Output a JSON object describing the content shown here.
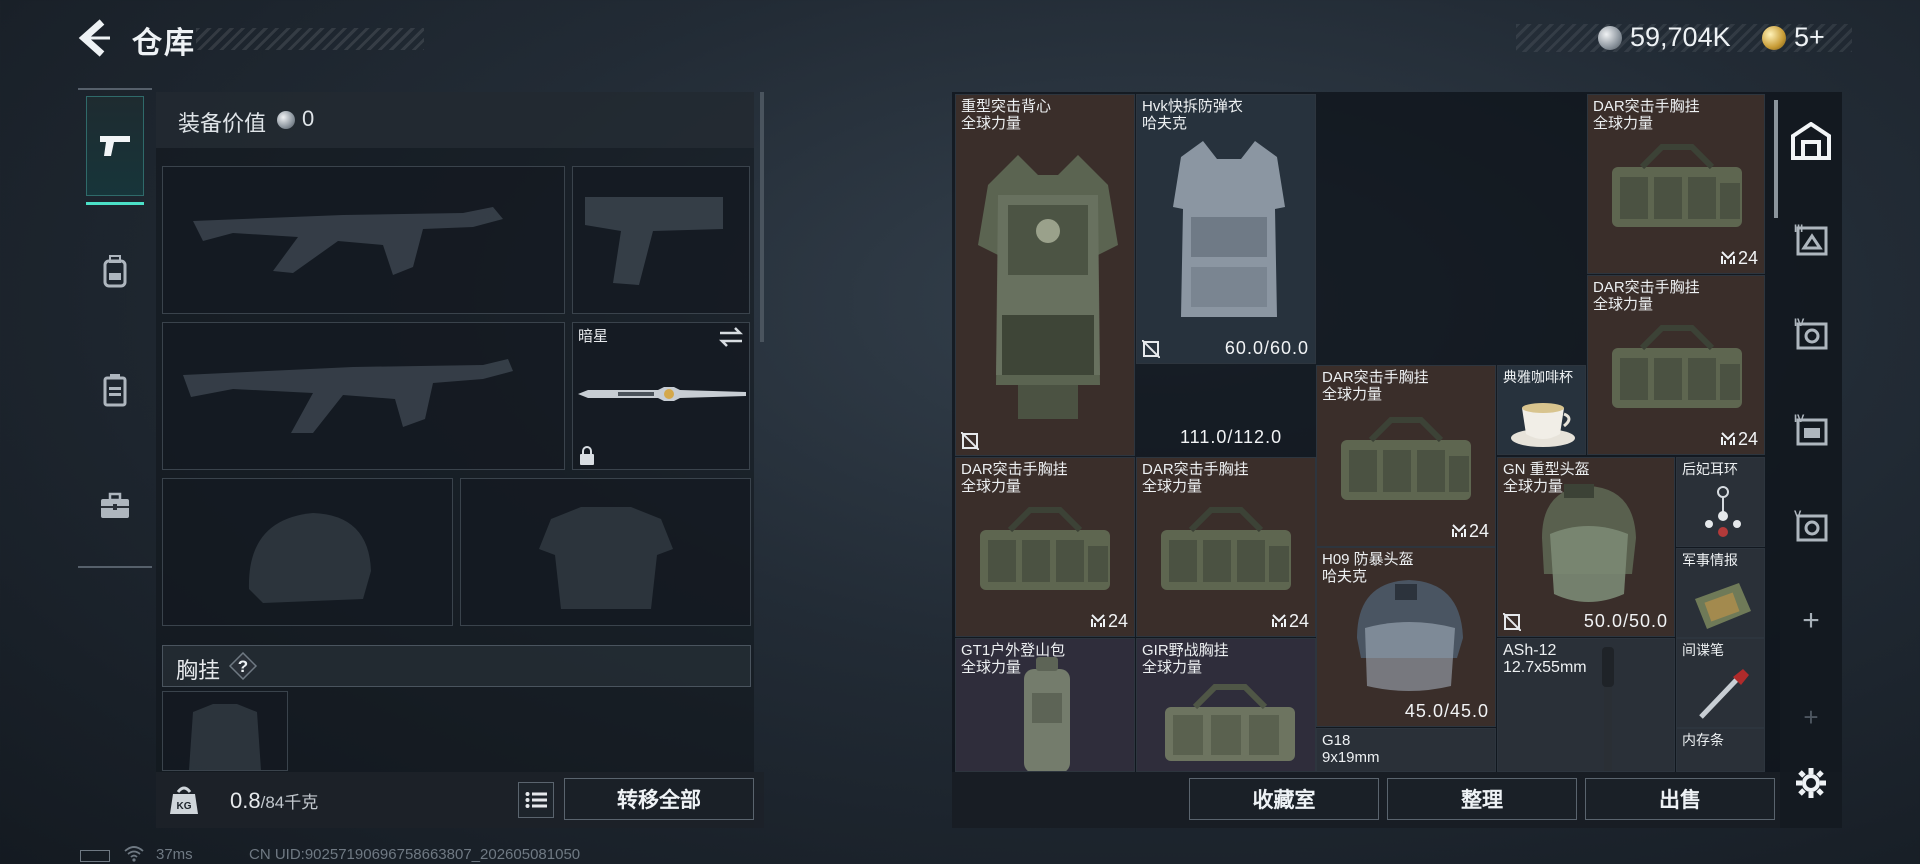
{
  "topbar": {
    "title": "仓库",
    "currency_silver": "59,704K",
    "currency_gold": "5+"
  },
  "equipment": {
    "value_label": "装备价值",
    "value": "0",
    "melee_name": "暗星",
    "rig_label": "胸挂",
    "rig_help": "?",
    "weight_value": "0.8",
    "weight_max": "/84千克",
    "transfer_label": "转移全部"
  },
  "status": {
    "ping": "37ms",
    "uid": "CN UID:902571906967586638​07_202605081050"
  },
  "stash": {
    "items": [
      {
        "id": "heavy-vest",
        "name": "重型突击背心",
        "sub": "全球力量",
        "durability": "111.0/112.0"
      },
      {
        "id": "hvk-vest",
        "name": "Hvk快拆防弹衣",
        "sub": "哈夫克",
        "durability": "60.0/60.0"
      },
      {
        "id": "dar-rig-1",
        "name": "DAR突击手胸挂",
        "sub": "全球力量",
        "count": "24"
      },
      {
        "id": "dar-rig-2",
        "name": "DAR突击手胸挂",
        "sub": "全球力量",
        "count": "24"
      },
      {
        "id": "dar-rig-3",
        "name": "DAR突击手胸挂",
        "sub": "全球力量",
        "count": "24"
      },
      {
        "id": "coffee-cup",
        "name": "典雅咖啡杯",
        "sub": ""
      },
      {
        "id": "dar-rig-4",
        "name": "DAR突击手胸挂",
        "sub": "全球力量",
        "count": "24"
      },
      {
        "id": "dar-rig-5",
        "name": "DAR突击手胸挂",
        "sub": "全球力量",
        "count": "24"
      },
      {
        "id": "gn-helmet",
        "name": "GN 重型头盔",
        "sub": "全球力量",
        "durability": "50.0/50.0"
      },
      {
        "id": "earring",
        "name": "后妃耳环",
        "sub": ""
      },
      {
        "id": "h09-helmet",
        "name": "H09 防暴头盔",
        "sub": "哈夫克",
        "durability": "45.0/45.0"
      },
      {
        "id": "intel",
        "name": "军事情报",
        "sub": ""
      },
      {
        "id": "gt1-pack",
        "name": "GT1户外登山包",
        "sub": "全球力量"
      },
      {
        "id": "gir-rig",
        "name": "GIR野战胸挂",
        "sub": "全球力量"
      },
      {
        "id": "ash-ammo",
        "name": "ASh-12",
        "sub": "12.7x55mm"
      },
      {
        "id": "spy-pen",
        "name": "间谍笔",
        "sub": ""
      },
      {
        "id": "g18-ammo",
        "name": "G18",
        "sub": "9x19mm"
      },
      {
        "id": "memory",
        "name": "内存条",
        "sub": ""
      }
    ],
    "buttons": {
      "collection": "收藏室",
      "organize": "整理",
      "sell": "出售"
    }
  },
  "rail": {
    "add": "+"
  },
  "colors": {
    "accent_teal": "#4be0c7",
    "brown_cell": "#3a2e2a",
    "blue_cell": "#27323d",
    "gray_cell": "#2a3038",
    "purple_cell": "#2f2d3b"
  },
  "icons": [
    "back-arrow-icon",
    "pistol-icon",
    "backpack-icon",
    "vest-icon",
    "briefcase-icon",
    "swap-icon",
    "lock-icon",
    "help-icon",
    "weight-icon",
    "list-icon",
    "home-icon",
    "settings-icon",
    "plus-icon",
    "broken-icon",
    "multiplier-icon"
  ]
}
